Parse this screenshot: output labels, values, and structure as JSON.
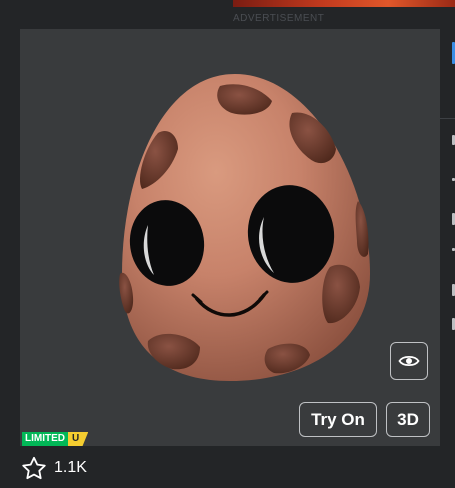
{
  "ad": {
    "label": "ADVERTISEMENT"
  },
  "viewer": {
    "eye_button_icon": "eye-icon",
    "try_on_label": "Try On",
    "view_3d_label": "3D"
  },
  "badge": {
    "limited_label": "LIMITED",
    "unique_label": "U",
    "colors": {
      "limited": "#02b757",
      "unique": "#f5cd30"
    }
  },
  "favorites": {
    "icon": "star-icon",
    "count": "1.1K"
  }
}
